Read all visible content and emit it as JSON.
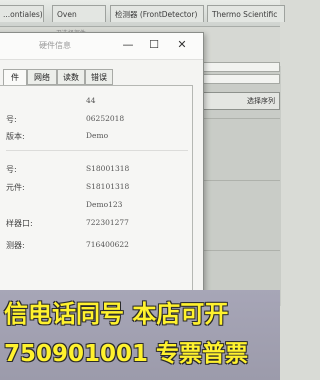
{
  "background_app": {
    "tabs": [
      "...ontiales)",
      "Oven",
      "检测器 (FrontDetector)",
      "Thermo Scientific"
    ],
    "status_text": "— — 卫选择部件",
    "select_button_label": "选择序列"
  },
  "dialog": {
    "title": "硬件信息",
    "controls": {
      "minimize": "—",
      "maximize": "☐",
      "close": "✕"
    },
    "tabs": [
      {
        "label": "件",
        "active": true
      },
      {
        "label": "网络",
        "active": false
      },
      {
        "label": "读数",
        "active": false
      },
      {
        "label": "错误",
        "active": false
      }
    ],
    "rows": [
      {
        "label": "",
        "value": "44"
      },
      {
        "label": "号:",
        "value": "06252018"
      },
      {
        "label": "版本:",
        "value": "Demo"
      },
      {
        "label": "号:",
        "value": "S18001318"
      },
      {
        "label": "元件:",
        "value": "S18101318"
      },
      {
        "label": "",
        "value": "Demo123"
      },
      {
        "label": "样器口:",
        "value": "722301277"
      },
      {
        "label": "测器:",
        "value": "716400622"
      }
    ]
  },
  "promo": {
    "line1": "信电话同号 本店可开",
    "line2": "750901001 专票普票"
  },
  "colors": {
    "promo_text": "#fff22e",
    "promo_background": "#a7a6b7"
  }
}
